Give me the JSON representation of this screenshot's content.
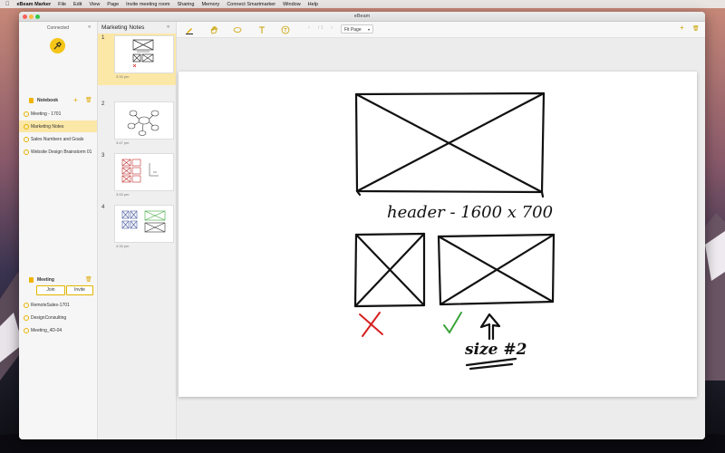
{
  "menubar": {
    "app_name": "eBeam Marker",
    "items": [
      "File",
      "Edit",
      "View",
      "Page",
      "Invite meeting room",
      "Sharing",
      "Memory",
      "Connect Smartmarker",
      "Window",
      "Help"
    ]
  },
  "window": {
    "title": "eBeam"
  },
  "sidebar": {
    "status": "Connected",
    "notebook_header": "Notebook",
    "notebooks": [
      {
        "label": "Meeting - 1701",
        "selected": false
      },
      {
        "label": "Marketing Notes",
        "selected": true
      },
      {
        "label": "Sales Numbers and Goals",
        "selected": false
      },
      {
        "label": "Website Design Brainstorm 01",
        "selected": false
      }
    ],
    "meeting_header": "Meeting",
    "join_label": "Join",
    "invite_label": "Invite",
    "meetings": [
      "RemoteSales-1701",
      "DesignConsulting",
      "Meeting_4D-04"
    ]
  },
  "pages": {
    "title": "Marketing Notes",
    "items": [
      {
        "num": "1",
        "time": "3:33 pm",
        "selected": true
      },
      {
        "num": "2",
        "time": "3:47 pm",
        "selected": false
      },
      {
        "num": "3",
        "time": "3:53 pm",
        "selected": false
      },
      {
        "num": "4",
        "time": "4:16 pm",
        "selected": false
      }
    ]
  },
  "toolbar": {
    "zoom_label": "Fit Page",
    "page_indicator": "/ 1"
  },
  "canvas": {
    "header_text": "header - 1600 x 700",
    "size_text": "size #2"
  },
  "colors": {
    "accent": "#f5c518",
    "selected_bg": "#fbe7a6",
    "mark_red": "#d62020",
    "mark_green": "#3aa43a"
  }
}
